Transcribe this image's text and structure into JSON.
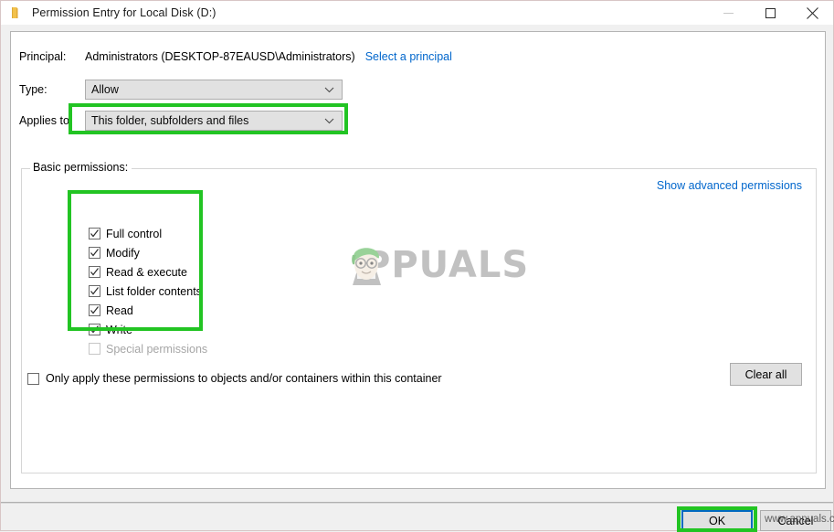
{
  "window": {
    "title": "Permission Entry for Local Disk (D:)",
    "icon": "folder-icon",
    "controls": {
      "minimize": "minimize-icon",
      "maximize": "maximize-icon",
      "close": "close-icon"
    }
  },
  "form": {
    "principal_label": "Principal:",
    "principal_value": "Administrators (DESKTOP-87EAUSD\\Administrators)",
    "select_principal_link": "Select a principal",
    "type_label": "Type:",
    "type_value": "Allow",
    "applies_to_label": "Applies to:",
    "applies_to_value": "This folder, subfolders and files"
  },
  "permissions": {
    "group_title": "Basic permissions:",
    "show_advanced_link": "Show advanced permissions",
    "items": [
      {
        "label": "Full control",
        "checked": true,
        "disabled": false
      },
      {
        "label": "Modify",
        "checked": true,
        "disabled": false
      },
      {
        "label": "Read & execute",
        "checked": true,
        "disabled": false
      },
      {
        "label": "List folder contents",
        "checked": true,
        "disabled": false
      },
      {
        "label": "Read",
        "checked": true,
        "disabled": false
      },
      {
        "label": "Write",
        "checked": true,
        "disabled": false
      },
      {
        "label": "Special permissions",
        "checked": false,
        "disabled": true
      }
    ],
    "only_apply_label": "Only apply these permissions to objects and/or containers within this container",
    "only_apply_checked": false,
    "clear_all_label": "Clear all"
  },
  "footer": {
    "ok_label": "OK",
    "cancel_label": "Cancel"
  },
  "watermark": {
    "brand": "PPUALS",
    "corner": "www.appuals.com"
  },
  "colors": {
    "highlight_green": "#22c423",
    "link_blue": "#0066cc",
    "focus_blue": "#0069c0",
    "control_face": "#e1e1e1",
    "panel_bg": "#ffffff",
    "window_bg": "#f0f0f0"
  }
}
